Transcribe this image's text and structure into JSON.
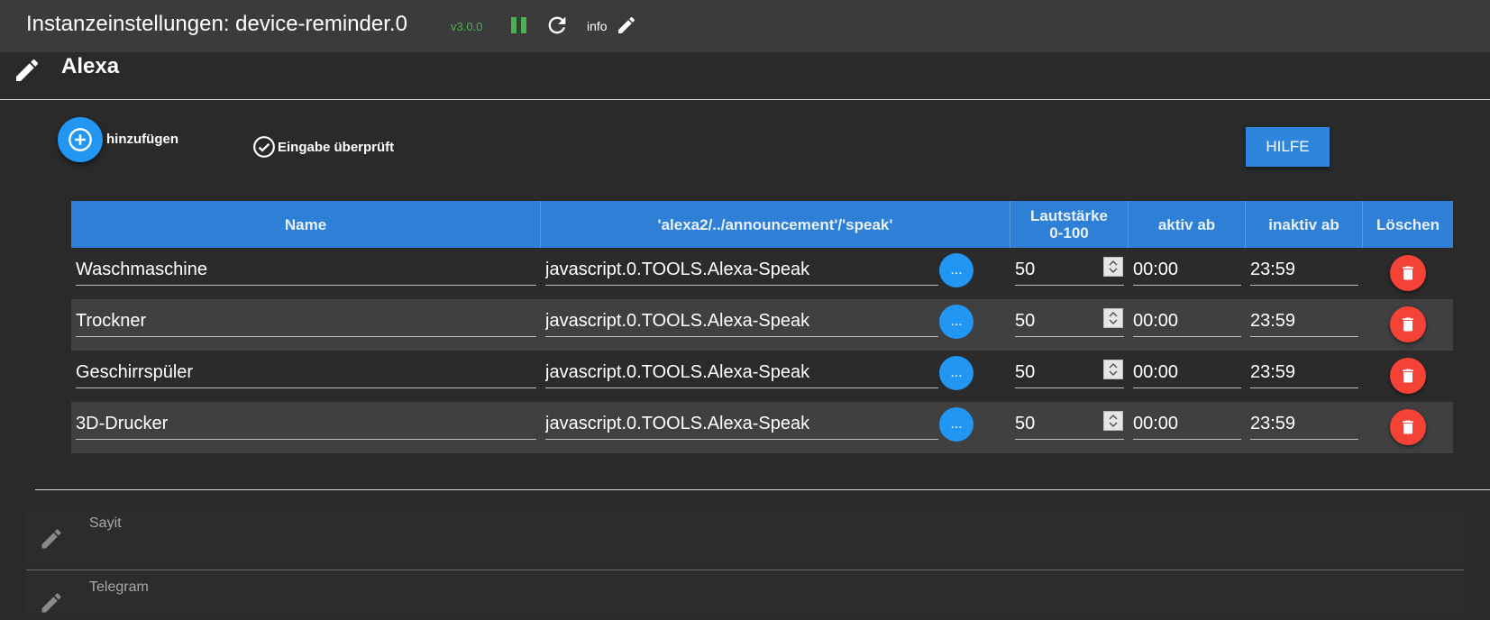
{
  "header": {
    "title": "Instanzeinstellungen: device-reminder.0",
    "version": "v3.0.0",
    "info_label": "info"
  },
  "section": {
    "title": "Alexa",
    "add_label": "hinzufügen",
    "check_label": "Eingabe überprüft",
    "help_label": "HILFE"
  },
  "table": {
    "headers": {
      "name": "Name",
      "path": "'alexa2/../announcement'/'speak'",
      "volume_line1": "Lautstärke",
      "volume_line2": "0-100",
      "active_from": "aktiv ab",
      "inactive_from": "inaktiv ab",
      "delete": "Löschen"
    },
    "rows": [
      {
        "name": "Waschmaschine",
        "path": "javascript.0.TOOLS.Alexa-Speak",
        "volume": "50",
        "active": "00:00",
        "inactive": "23:59"
      },
      {
        "name": "Trockner",
        "path": "javascript.0.TOOLS.Alexa-Speak",
        "volume": "50",
        "active": "00:00",
        "inactive": "23:59"
      },
      {
        "name": "Geschirrspüler",
        "path": "javascript.0.TOOLS.Alexa-Speak",
        "volume": "50",
        "active": "00:00",
        "inactive": "23:59"
      },
      {
        "name": "3D-Drucker",
        "path": "javascript.0.TOOLS.Alexa-Speak",
        "volume": "50",
        "active": "00:00",
        "inactive": "23:59"
      }
    ],
    "select_button_label": "..."
  },
  "panels": [
    {
      "label": "Sayit"
    },
    {
      "label": "Telegram"
    }
  ],
  "colors": {
    "accent": "#2196f3",
    "table_header": "#2e80d6",
    "delete": "#f44336",
    "running": "#4caf50"
  }
}
